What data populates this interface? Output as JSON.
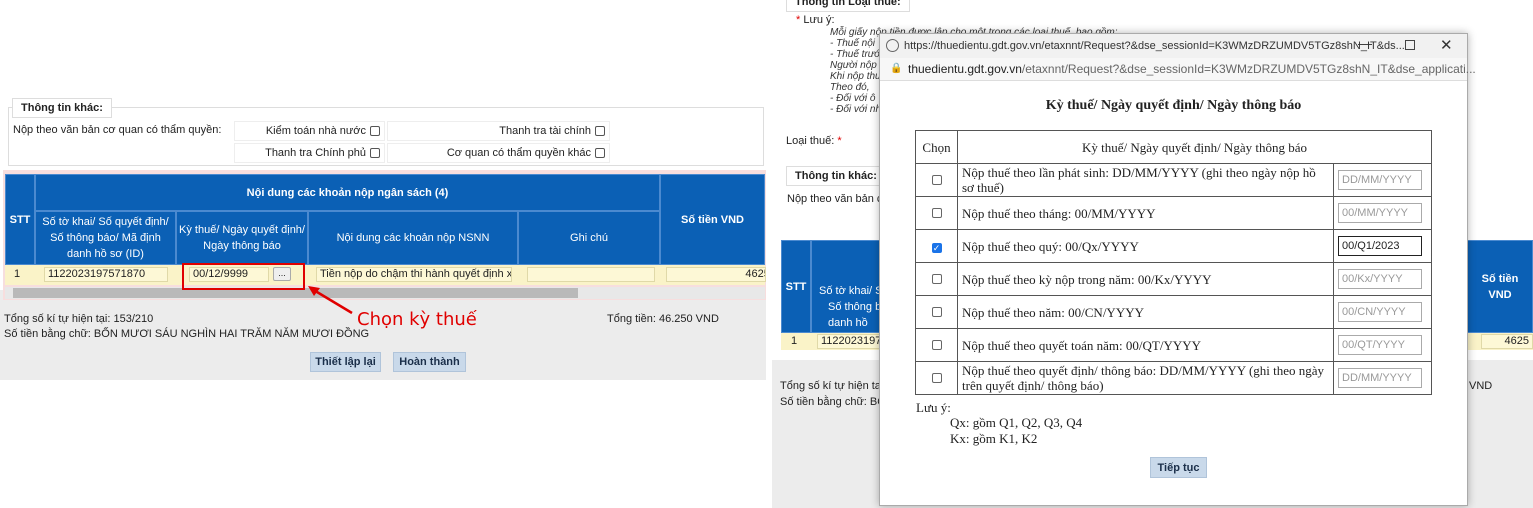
{
  "left": {
    "other_info": {
      "legend": "Thông tin khác:",
      "label": "Nộp theo văn bản cơ quan có thẩm quyền:",
      "options": [
        "Kiểm toán nhà nước",
        "Thanh tra tài chính",
        "Thanh tra Chính phủ",
        "Cơ quan có thẩm quyền khác"
      ]
    },
    "table": {
      "group_header": "Nội dung các khoản nộp ngân sách (4)",
      "headers": {
        "stt": "STT",
        "doc_no": "Số tờ khai/ Số quyết định/ Số thông báo/ Mã định danh hồ sơ (ID)",
        "period": "Kỳ thuế/ Ngày quyết định/ Ngày thông báo",
        "content": "Nội dung các khoản nộp NSNN",
        "note": "Ghi chú",
        "amount": "Số tiền VND"
      },
      "row": {
        "stt": "1",
        "doc_no": "1122023197571870",
        "period": "00/12/9999",
        "picker": "...",
        "content": "Tiền nộp do chậm thi hành quyết định x",
        "note": "",
        "amount": "46250"
      }
    },
    "annotation": "Chọn kỳ thuế",
    "char_count": "Tổng số kí tự hiện tại: 153/210",
    "amount_words": "Số tiền bằng chữ: BỐN MƯƠI SÁU NGHÌN HAI TRĂM NĂM MƯƠI ĐỒNG",
    "total": "Tổng tiền: 46.250 VND",
    "buttons": {
      "reset": "Thiết lập lại",
      "finish": "Hoàn thành"
    }
  },
  "right_bg": {
    "legend": "Thông tin Loại thuế:",
    "note_label": "Lưu ý:",
    "note_lines": [
      "Mỗi giấy nộp tiền được lập cho một trong các loại thuế, bao gồm:",
      "- Thuế nội",
      "- Thuế trướ",
      "Người nộp",
      "Khi nộp thu",
      "Theo đó,",
      "- Đối với ô",
      "- Đối với nh"
    ],
    "tax_type_label": "Loại thuế:",
    "other_legend": "Thông tin khác:",
    "other_label": "Nộp theo văn bản c",
    "stt": "STT",
    "doc_header": [
      "Số tờ khai/ S",
      "Số thông b",
      "danh hồ"
    ],
    "amount_header": "Số tiền VND",
    "row_stt": "1",
    "row_doc": "11220231971",
    "row_amount": "4625",
    "char_count": "Tổng số kí tự hiện ta",
    "amount_words": "Số tiền bằng chữ: BỐ",
    "total_tail": "VND"
  },
  "popup": {
    "window_title": "https://thuedientu.gdt.gov.vn/etaxnnt/Request?&dse_sessionId=K3WMzDRZUMDV5TGz8shN_IT&ds...",
    "url_host": "thuedientu.gdt.gov.vn",
    "url_path": "/etaxnnt/Request?&dse_sessionId=K3WMzDRZUMDV5TGz8shN_IT&dse_applicati...",
    "heading": "Kỳ thuế/ Ngày quyết định/ Ngày thông báo",
    "col_choose": "Chọn",
    "col_period": "Kỳ thuế/ Ngày quyết định/ Ngày thông báo",
    "rows": [
      {
        "label": "Nộp thuế theo lần phát sinh: DD/MM/YYYY (ghi theo ngày nộp hồ sơ thuế)",
        "placeholder": "DD/MM/YYYY",
        "value": "",
        "checked": false
      },
      {
        "label": "Nộp thuế theo tháng: 00/MM/YYYY",
        "placeholder": "00/MM/YYYY",
        "value": "",
        "checked": false
      },
      {
        "label": "Nộp thuế theo quý: 00/Qx/YYYY",
        "placeholder": "00/Qx/YYYY",
        "value": "00/Q1/2023",
        "checked": true
      },
      {
        "label": "Nộp thuế theo kỳ nộp trong năm: 00/Kx/YYYY",
        "placeholder": "00/Kx/YYYY",
        "value": "",
        "checked": false
      },
      {
        "label": "Nộp thuế theo năm: 00/CN/YYYY",
        "placeholder": "00/CN/YYYY",
        "value": "",
        "checked": false
      },
      {
        "label": "Nộp thuế theo quyết toán năm: 00/QT/YYYY",
        "placeholder": "00/QT/YYYY",
        "value": "",
        "checked": false
      },
      {
        "label": "Nộp thuế theo quyết định/ thông báo: DD/MM/YYYY (ghi theo ngày trên quyết định/ thông báo)",
        "placeholder": "DD/MM/YYYY",
        "value": "",
        "checked": false
      }
    ],
    "note_label": "Lưu ý:",
    "notes": [
      "Qx: gồm Q1, Q2, Q3, Q4",
      "Kx: gồm K1, K2"
    ],
    "continue": "Tiếp tục"
  },
  "colors": {
    "header_blue": "#0b60b5",
    "row_yellow": "#faf3c8",
    "annotation_red": "#e00000",
    "checkbox_blue": "#1a73e8"
  }
}
